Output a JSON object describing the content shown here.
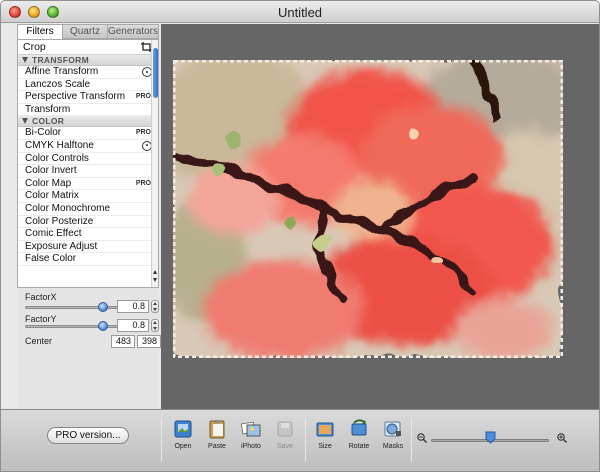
{
  "window": {
    "title": "Untitled"
  },
  "tabs": [
    {
      "label": "Filters",
      "active": true
    },
    {
      "label": "Quartz",
      "active": false
    },
    {
      "label": "Generators",
      "active": false
    }
  ],
  "crop": {
    "label": "Crop",
    "icon": "crop-icon"
  },
  "sections": [
    {
      "label": "TRANSFORM",
      "items": [
        {
          "label": "Affine Transform",
          "badge": "target"
        },
        {
          "label": "Lanczos Scale",
          "badge": ""
        },
        {
          "label": "Perspective Transform",
          "badge": "PRO"
        },
        {
          "label": "Transform",
          "badge": ""
        }
      ]
    },
    {
      "label": "COLOR",
      "items": [
        {
          "label": "Bi-Color",
          "badge": "PRO"
        },
        {
          "label": "CMYK Halftone",
          "badge": "target"
        },
        {
          "label": "Color Controls",
          "badge": ""
        },
        {
          "label": "Color Invert",
          "badge": ""
        },
        {
          "label": "Color Map",
          "badge": "PRO"
        },
        {
          "label": "Color Matrix",
          "badge": ""
        },
        {
          "label": "Color Monochrome",
          "badge": ""
        },
        {
          "label": "Color Posterize",
          "badge": ""
        },
        {
          "label": "Comic Effect",
          "badge": ""
        },
        {
          "label": "Exposure Adjust",
          "badge": ""
        },
        {
          "label": "False Color",
          "badge": ""
        }
      ]
    }
  ],
  "params": {
    "factor_x": {
      "label": "FactorX",
      "value": "0.8",
      "slider_fraction": 0.8
    },
    "factor_y": {
      "label": "FactorY",
      "value": "0.8",
      "slider_fraction": 0.8
    },
    "center": {
      "label": "Center",
      "x": "483",
      "y": "398"
    }
  },
  "toolbar": {
    "pro_label": "PRO version...",
    "tools": [
      {
        "label": "Open",
        "icon": "open-icon",
        "enabled": true
      },
      {
        "label": "Paste",
        "icon": "paste-icon",
        "enabled": true
      },
      {
        "label": "iPhoto",
        "icon": "iphoto-icon",
        "enabled": true
      },
      {
        "label": "Save",
        "icon": "save-icon",
        "enabled": false
      },
      {
        "label": "Size",
        "icon": "size-icon",
        "enabled": true
      },
      {
        "label": "Rotate",
        "icon": "rotate-icon",
        "enabled": true
      },
      {
        "label": "Masks",
        "icon": "masks-icon",
        "enabled": true
      }
    ],
    "zoom_fraction": 0.5
  },
  "colors": {
    "canvas_bg": "#666666",
    "accent": "#3a78d6",
    "photo_main": "#f05a4a"
  }
}
